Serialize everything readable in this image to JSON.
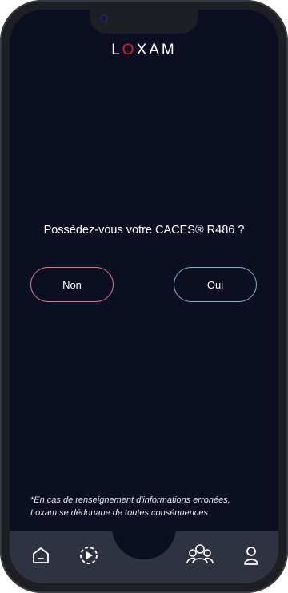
{
  "app": {
    "brand": "LOXAM"
  },
  "main": {
    "question": "Possèdez-vous votre CACES® R486 ?",
    "buttons": {
      "no": "Non",
      "yes": "Oui"
    }
  },
  "footer": {
    "disclaimer_line1": "*En cas de renseignement d'informations erronées,",
    "disclaimer_line2": "Loxam se dédouane de toutes conséquences"
  },
  "tabbar": {
    "icons": [
      "home-icon",
      "play-icon",
      "community-icon",
      "profile-icon"
    ]
  },
  "colors": {
    "background": "#0c0e22",
    "brand_red": "#e21b30",
    "no_border": "#e07a85",
    "yes_border": "#7fb3c6",
    "tabbar": "#2f3240"
  }
}
